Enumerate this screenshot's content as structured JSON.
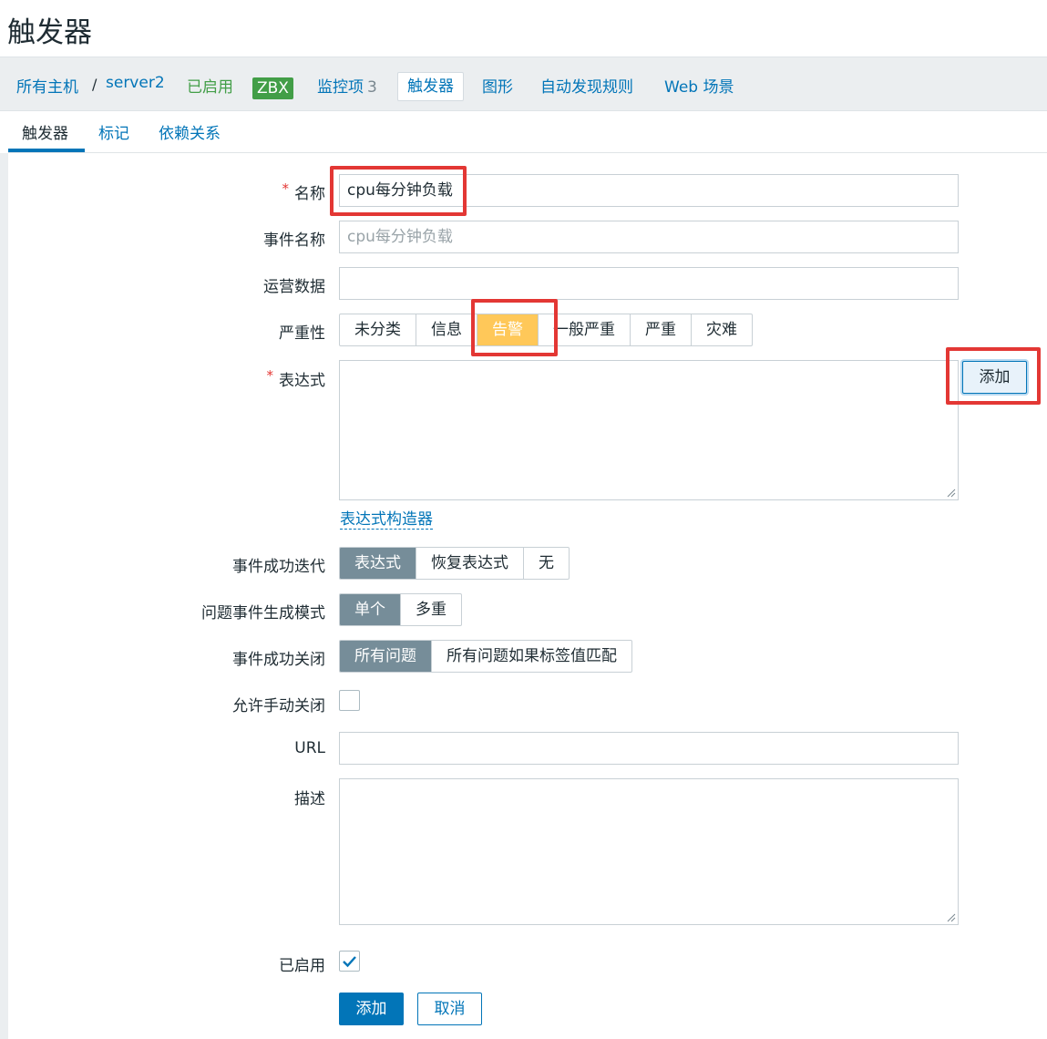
{
  "page": {
    "title": "触发器"
  },
  "host_nav": {
    "all_hosts": "所有主机",
    "separator": "/",
    "host": "server2",
    "status": "已启用",
    "zbx_badge": "ZBX",
    "items_label": "监控项",
    "items_count": "3",
    "triggers": "触发器",
    "graphs": "图形",
    "discovery": "自动发现规则",
    "web": "Web 场景"
  },
  "tabs": [
    "触发器",
    "标记",
    "依赖关系"
  ],
  "form": {
    "name": {
      "label": "名称",
      "value": "cpu每分钟负载"
    },
    "event_name": {
      "label": "事件名称",
      "placeholder": "cpu每分钟负载"
    },
    "opdata": {
      "label": "运营数据",
      "value": ""
    },
    "severity": {
      "label": "严重性",
      "options": [
        "未分类",
        "信息",
        "告警",
        "一般严重",
        "严重",
        "灾难"
      ],
      "selected": "告警"
    },
    "expression": {
      "label": "表达式",
      "value": "",
      "add_button": "添加"
    },
    "constructor_link": "表达式构造器",
    "ok_event_generation": {
      "label": "事件成功迭代",
      "options": [
        "表达式",
        "恢复表达式",
        "无"
      ],
      "selected": "表达式"
    },
    "problem_mode": {
      "label": "问题事件生成模式",
      "options": [
        "单个",
        "多重"
      ],
      "selected": "单个"
    },
    "ok_event_close": {
      "label": "事件成功关闭",
      "options": [
        "所有问题",
        "所有问题如果标签值匹配"
      ],
      "selected": "所有问题"
    },
    "manual_close": {
      "label": "允许手动关闭",
      "checked": false
    },
    "url": {
      "label": "URL",
      "value": ""
    },
    "description": {
      "label": "描述",
      "value": ""
    },
    "enabled": {
      "label": "已启用",
      "checked": true
    }
  },
  "buttons": {
    "add": "添加",
    "cancel": "取消"
  },
  "colors": {
    "accent": "#0275b8",
    "warning": "#ffc859",
    "selected": "#768d99",
    "highlight": "#e33734",
    "enabled": "#429e47"
  }
}
